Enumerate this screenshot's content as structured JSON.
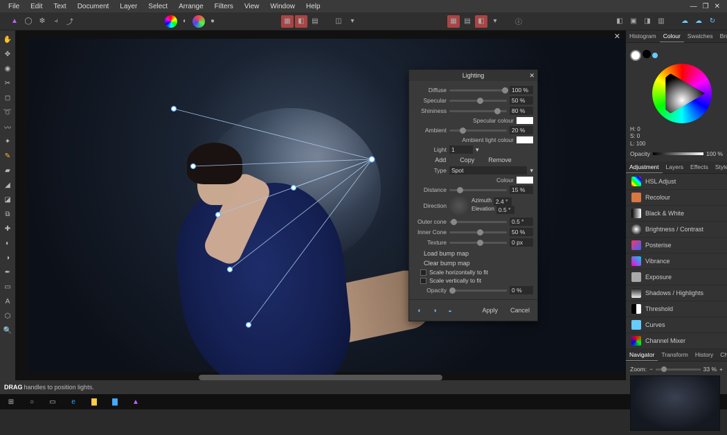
{
  "menubar": {
    "items": [
      "File",
      "Edit",
      "Text",
      "Document",
      "Layer",
      "Select",
      "Arrange",
      "Filters",
      "View",
      "Window",
      "Help"
    ]
  },
  "dialog": {
    "title": "Lighting",
    "diffuse_lbl": "Diffuse",
    "diffuse_val": "100 %",
    "specular_lbl": "Specular",
    "specular_val": "50 %",
    "shininess_lbl": "Shininess",
    "shininess_val": "80 %",
    "spec_colour_lbl": "Specular colour",
    "ambient_lbl": "Ambient",
    "ambient_val": "20 %",
    "amb_colour_lbl": "Ambient light colour",
    "light_lbl": "Light",
    "light_val": "1",
    "add": "Add",
    "copy": "Copy",
    "remove": "Remove",
    "type_lbl": "Type",
    "type_val": "Spot",
    "colour_lbl": "Colour",
    "distance_lbl": "Distance",
    "distance_val": "15 %",
    "direction_lbl": "Direction",
    "azimuth_lbl": "Azimuth",
    "azimuth_val": "2.4 °",
    "elevation_lbl": "Elevation",
    "elevation_val": "0.5 °",
    "outer_lbl": "Outer cone",
    "outer_val": "0.5 °",
    "inner_lbl": "Inner Cone",
    "inner_val": "50 %",
    "texture_lbl": "Texture",
    "texture_val": "0 px",
    "load_bump": "Load bump map",
    "clear_bump": "Clear bump map",
    "scale_h": "Scale horizontally to fit",
    "scale_v": "Scale vertically to fit",
    "opacity_lbl": "Opacity",
    "opacity_val": "0 %",
    "apply": "Apply",
    "cancel": "Cancel"
  },
  "right": {
    "tabs1": [
      "Histogram",
      "Colour",
      "Swatches",
      "Brushes"
    ],
    "h": "H: 0",
    "s": "S: 0",
    "l": "L: 100",
    "op_lbl": "Opacity",
    "op_val": "100 %",
    "tabs2": [
      "Adjustment",
      "Layers",
      "Effects",
      "Styles"
    ],
    "adjustments": [
      {
        "name": "HSL Adjust",
        "color": "linear-gradient(45deg,red,yellow,lime,cyan,blue,magenta)"
      },
      {
        "name": "Recolour",
        "color": "#d97742"
      },
      {
        "name": "Black & White",
        "color": "linear-gradient(90deg,#000,#fff)"
      },
      {
        "name": "Brightness / Contrast",
        "color": "radial-gradient(circle,#fff,#000)"
      },
      {
        "name": "Posterise",
        "color": "linear-gradient(135deg,#ff3366,#3366ff)"
      },
      {
        "name": "Vibrance",
        "color": "linear-gradient(45deg,#f0c,#0cf)"
      },
      {
        "name": "Exposure",
        "color": "#aaa"
      },
      {
        "name": "Shadows / Highlights",
        "color": "linear-gradient(180deg,#222,#eee)"
      },
      {
        "name": "Threshold",
        "color": "linear-gradient(90deg,#000 50%,#fff 50%)"
      },
      {
        "name": "Curves",
        "color": "#6cf"
      },
      {
        "name": "Channel Mixer",
        "color": "conic-gradient(red,lime,blue,red)"
      }
    ],
    "tabs3": [
      "Navigator",
      "Transform",
      "History",
      "Channels"
    ],
    "zoom_lbl": "Zoom:",
    "zoom_val": "33 %"
  },
  "status": {
    "drag": "DRAG",
    "hint": "handles to position lights."
  }
}
